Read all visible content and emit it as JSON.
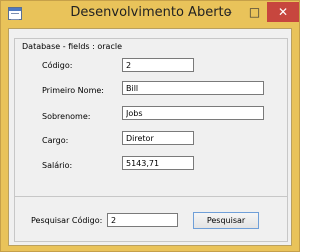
{
  "window": {
    "title": "Desenvolvimento Aberto",
    "minimize_glyph": "–",
    "maximize_glyph": "□",
    "close_glyph": "✕"
  },
  "database_group": {
    "legend": "Database - fields : oracle",
    "fields": [
      {
        "label": "Código:",
        "value": "2"
      },
      {
        "label": "Primeiro Nome:",
        "value": "Bill"
      },
      {
        "label": "Sobrenome:",
        "value": "Jobs"
      },
      {
        "label": "Cargo:",
        "value": "Diretor"
      },
      {
        "label": "Salário:",
        "value": "5143,71"
      }
    ]
  },
  "search_group": {
    "label": "Pesquisar Código:",
    "value": "2",
    "button_label": "Pesquisar"
  }
}
